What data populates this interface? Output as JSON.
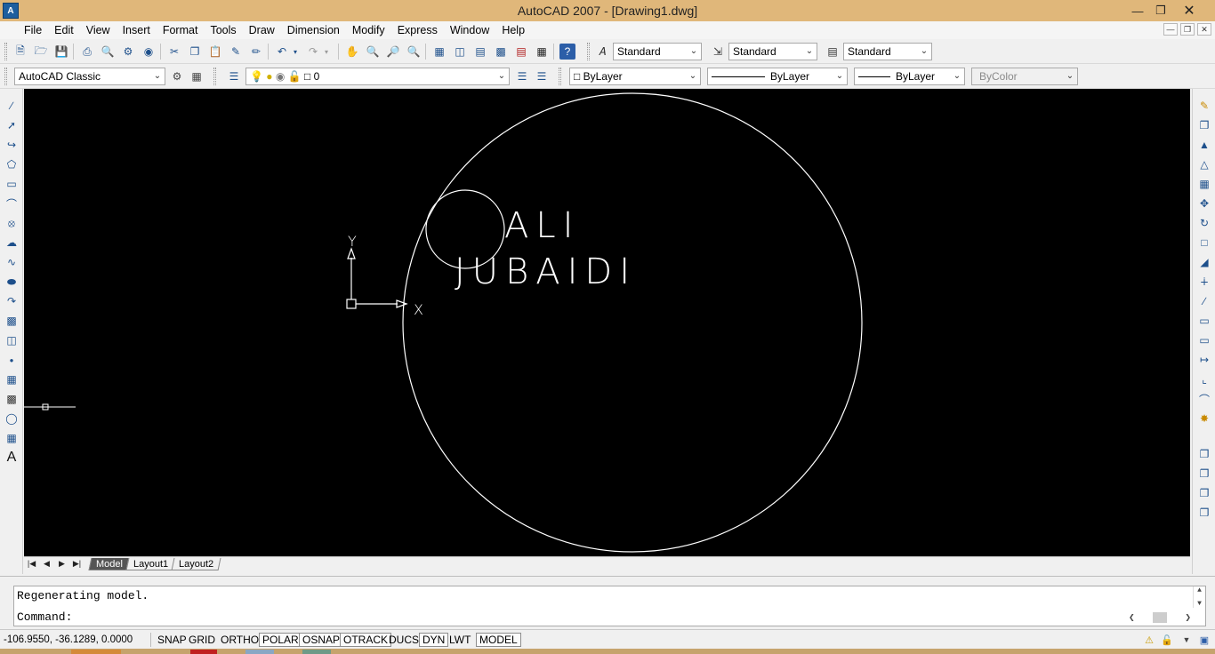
{
  "window": {
    "title": "AutoCAD 2007 - [Drawing1.dwg]",
    "icon": "autocad-app-icon",
    "icon_glyph": "A"
  },
  "menu": [
    "File",
    "Edit",
    "View",
    "Insert",
    "Format",
    "Tools",
    "Draw",
    "Dimension",
    "Modify",
    "Express",
    "Window",
    "Help"
  ],
  "styles_toolbar": {
    "text_style": "Standard",
    "dim_style": "Standard",
    "table_style": "Standard"
  },
  "workspace": {
    "name": "AutoCAD Classic"
  },
  "layers": {
    "current_layer": "0"
  },
  "properties": {
    "color": "ByLayer",
    "linetype": "ByLayer",
    "lineweight": "ByLayer",
    "plot_style": "ByColor"
  },
  "drawing": {
    "text_line1": "ALI",
    "text_line2": "JUBAIDI",
    "ucs_x_label": "X",
    "ucs_y_label": "Y",
    "background": "#000000",
    "entity_color": "#ffffff"
  },
  "layout_tabs": [
    "Model",
    "Layout1",
    "Layout2"
  ],
  "active_tab": "Model",
  "command": {
    "history": "Regenerating model.",
    "prompt": "Command:"
  },
  "status": {
    "coordinates": "-106.9550, -36.1289, 0.0000",
    "toggles": [
      {
        "label": "SNAP",
        "on": false
      },
      {
        "label": "GRID",
        "on": false
      },
      {
        "label": "ORTHO",
        "on": false
      },
      {
        "label": "POLAR",
        "on": true
      },
      {
        "label": "OSNAP",
        "on": true
      },
      {
        "label": "OTRACK",
        "on": true
      },
      {
        "label": "DUCS",
        "on": false
      },
      {
        "label": "DYN",
        "on": true
      },
      {
        "label": "LWT",
        "on": false
      },
      {
        "label": "MODEL",
        "on": true
      }
    ]
  }
}
